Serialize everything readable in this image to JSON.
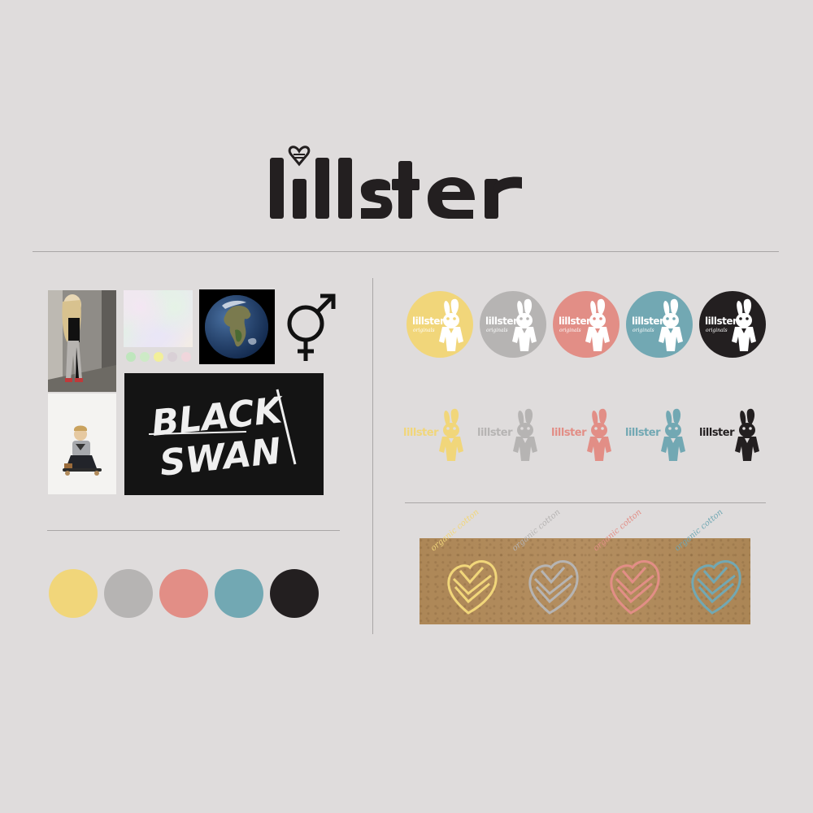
{
  "brand": {
    "name": "lillster"
  },
  "moodboard": {
    "palette_dots": [
      "#bfe6bd",
      "#cdeac6",
      "#f2ef9a",
      "#d9d0d6",
      "#f0d6dc"
    ],
    "black_swan": {
      "line1": "BLACK",
      "line2": "SWAN"
    }
  },
  "palette": {
    "colors": [
      "#f1d67a",
      "#b6b4b3",
      "#e28e86",
      "#72a8b3",
      "#231f20"
    ]
  },
  "badges": {
    "wordmark": "lillster",
    "sub": "originals",
    "colors": [
      "#f1d67a",
      "#b6b4b3",
      "#e28e86",
      "#72a8b3",
      "#231f20"
    ]
  },
  "marks": {
    "wordmark": "lillster",
    "colors": [
      "#f1d67a",
      "#b6b4b3",
      "#e28e86",
      "#72a8b3",
      "#231f20"
    ]
  },
  "organic_tags": {
    "label": "organic cotton",
    "colors": [
      "#f1d67a",
      "#b6b4b3",
      "#e28e86",
      "#72a8b3"
    ]
  }
}
